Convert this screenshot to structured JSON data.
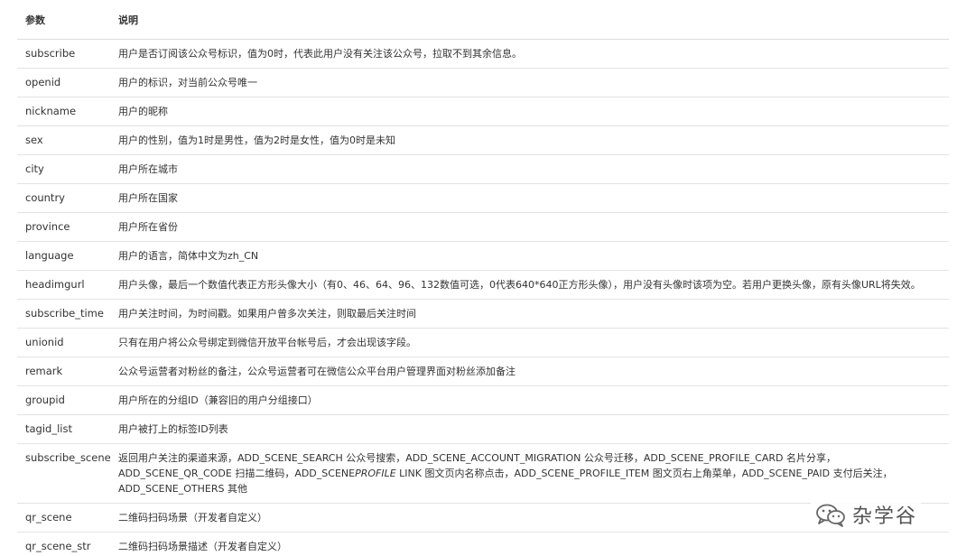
{
  "table": {
    "headers": {
      "param": "参数",
      "desc": "说明"
    },
    "rows": [
      {
        "name": "subscribe",
        "desc": "用户是否订阅该公众号标识，值为0时，代表此用户没有关注该公众号，拉取不到其余信息。"
      },
      {
        "name": "openid",
        "desc": "用户的标识，对当前公众号唯一"
      },
      {
        "name": "nickname",
        "desc": "用户的昵称"
      },
      {
        "name": "sex",
        "desc": "用户的性别，值为1时是男性，值为2时是女性，值为0时是未知"
      },
      {
        "name": "city",
        "desc": "用户所在城市"
      },
      {
        "name": "country",
        "desc": "用户所在国家"
      },
      {
        "name": "province",
        "desc": "用户所在省份"
      },
      {
        "name": "language",
        "desc": "用户的语言，简体中文为zh_CN"
      },
      {
        "name": "headimgurl",
        "desc": "用户头像，最后一个数值代表正方形头像大小（有0、46、64、96、132数值可选，0代表640*640正方形头像），用户没有头像时该项为空。若用户更换头像，原有头像URL将失效。"
      },
      {
        "name": "subscribe_time",
        "desc": "用户关注时间，为时间戳。如果用户曾多次关注，则取最后关注时间"
      },
      {
        "name": "unionid",
        "desc": "只有在用户将公众号绑定到微信开放平台帐号后，才会出现该字段。"
      },
      {
        "name": "remark",
        "desc": "公众号运营者对粉丝的备注，公众号运营者可在微信公众平台用户管理界面对粉丝添加备注"
      },
      {
        "name": "groupid",
        "desc": "用户所在的分组ID（兼容旧的用户分组接口）"
      },
      {
        "name": "tagid_list",
        "desc": "用户被打上的标签ID列表"
      },
      {
        "name": "subscribe_scene",
        "desc_before": "返回用户关注的渠道来源，ADD_SCENE_SEARCH 公众号搜索，ADD_SCENE_ACCOUNT_MIGRATION 公众号迁移，ADD_SCENE_PROFILE_CARD 名片分享，ADD_SCENE_QR_CODE 扫描二维码，ADD_SCENE",
        "desc_italic": "PROFILE",
        "desc_after": " LINK 图文页内名称点击，ADD_SCENE_PROFILE_ITEM 图文页右上角菜单，ADD_SCENE_PAID 支付后关注，ADD_SCENE_OTHERS 其他"
      },
      {
        "name": "qr_scene",
        "desc": "二维码扫码场景（开发者自定义）"
      },
      {
        "name": "qr_scene_str",
        "desc": "二维码扫码场景描述（开发者自定义）"
      }
    ]
  },
  "watermark": {
    "text": "杂学谷",
    "icon": "wechat-icon"
  }
}
